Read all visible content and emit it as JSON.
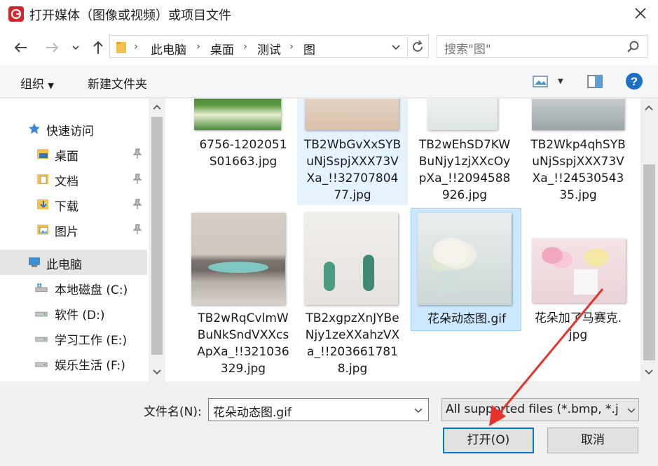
{
  "window": {
    "title": "打开媒体（图像或视频）或项目文件"
  },
  "address": {
    "crumbs": [
      "此电脑",
      "桌面",
      "测试",
      "图"
    ],
    "search_placeholder": "搜索\"图\""
  },
  "toolbar": {
    "organize": "组织",
    "new_folder": "新建文件夹"
  },
  "nav": {
    "quick_access": "快速访问",
    "pinned": [
      "桌面",
      "文档",
      "下载",
      "图片"
    ],
    "this_pc": "此电脑",
    "drives": [
      "本地磁盘 (C:)",
      "软件 (D:)",
      "学习工作 (E:)",
      "娱乐生活 (F:)"
    ]
  },
  "files": [
    {
      "name": "6756-1202051S01663.jpg",
      "lines": [
        "6756-1202051",
        "S01663.jpg"
      ]
    },
    {
      "name": "TB2WbGvXxSYBuNjSspjXXX73VXa_!!3270780477.jpg",
      "lines": [
        "TB2WbGvXxSYB",
        "uNjSspjXXX73V",
        "Xa_!!32707804",
        "77.jpg"
      ]
    },
    {
      "name": "TB2wEhSD7KWBuNjy1zjXXcOypXa_!!2094588926.jpg",
      "lines": [
        "TB2wEhSD7KW",
        "BuNjy1zjXXcOy",
        "pXa_!!2094588",
        "926.jpg"
      ]
    },
    {
      "name": "TB2Wkp4qhSYBuNjSspjXXX73VXa_!!2453054335.jpg",
      "lines": [
        "TB2Wkp4qhSYB",
        "uNjSspjXXX73V",
        "Xa_!!24530543",
        "35.jpg"
      ]
    },
    {
      "name": "TB2wRqCvlmWBuNkSndVXXcsApXa_!!321036329.jpg",
      "lines": [
        "TB2wRqCvlmW",
        "BuNkSndVXXcs",
        "ApXa_!!321036",
        "329.jpg"
      ]
    },
    {
      "name": "TB2xgpzXnJYBeNjy1zeXXahzVXa_!!2036617818.jpg",
      "lines": [
        "TB2xgpzXnJYBe",
        "Njy1zeXXahzVX",
        "a_!!203661781",
        "8.jpg"
      ]
    },
    {
      "name": "花朵动态图.gif",
      "lines": [
        "花朵动态图.gif"
      ]
    },
    {
      "name": "花朵加了马赛克.jpg",
      "lines": [
        "花朵加了马赛克.",
        "jpg"
      ]
    }
  ],
  "footer": {
    "filename_label": "文件名(N):",
    "filename_value": "花朵动态图.gif",
    "filetype_value": "All supported files (*.bmp, *.j",
    "open_button": "打开(O)",
    "cancel_button": "取消"
  },
  "colors": {
    "accent": "#0078d7",
    "selection": "#cce8ff",
    "app_red": "#d7262b",
    "arrow": "#e8322b"
  }
}
